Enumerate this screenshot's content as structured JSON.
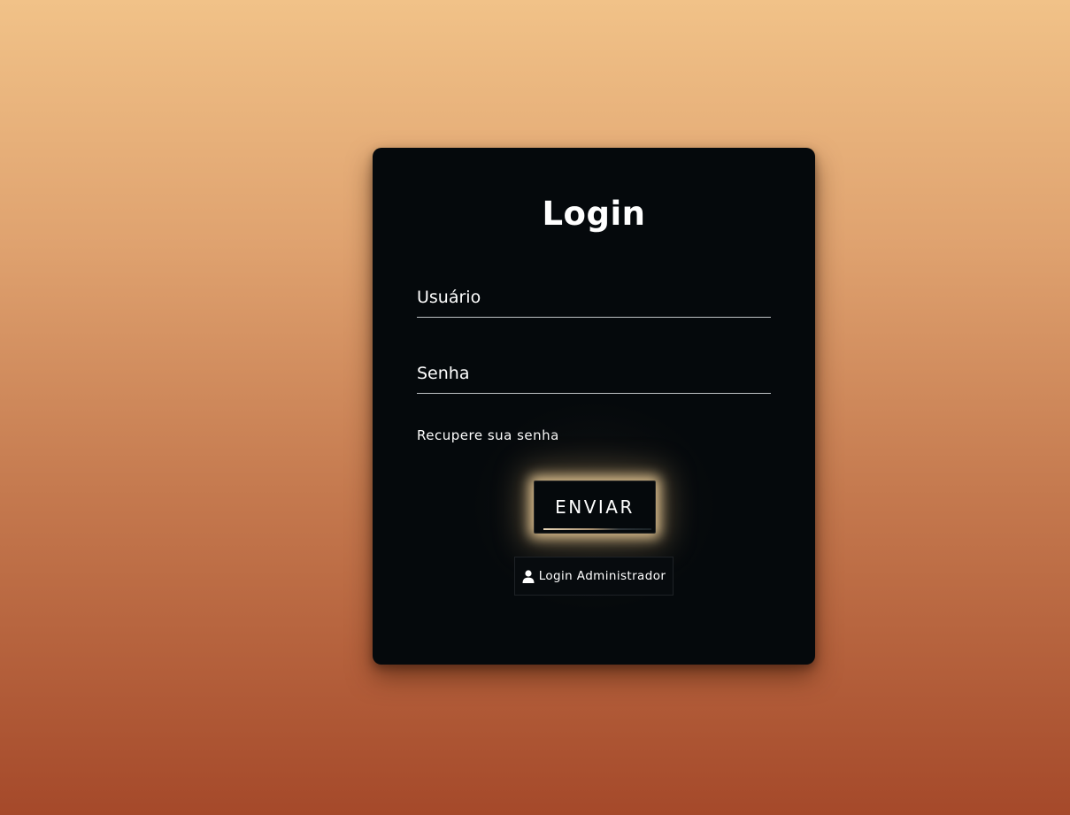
{
  "login": {
    "title": "Login",
    "username_placeholder": "Usuário",
    "password_placeholder": "Senha",
    "forgot_password": "Recupere sua senha",
    "submit_label": "ENVIAR",
    "admin_login_label": "Login Administrador",
    "admin_icon": "user-icon"
  },
  "colors": {
    "card_background": "#05090c",
    "text": "#ffffff",
    "button_glow": "#f6d6a0",
    "background_top": "#f1c288",
    "background_bottom": "#a5492a"
  }
}
